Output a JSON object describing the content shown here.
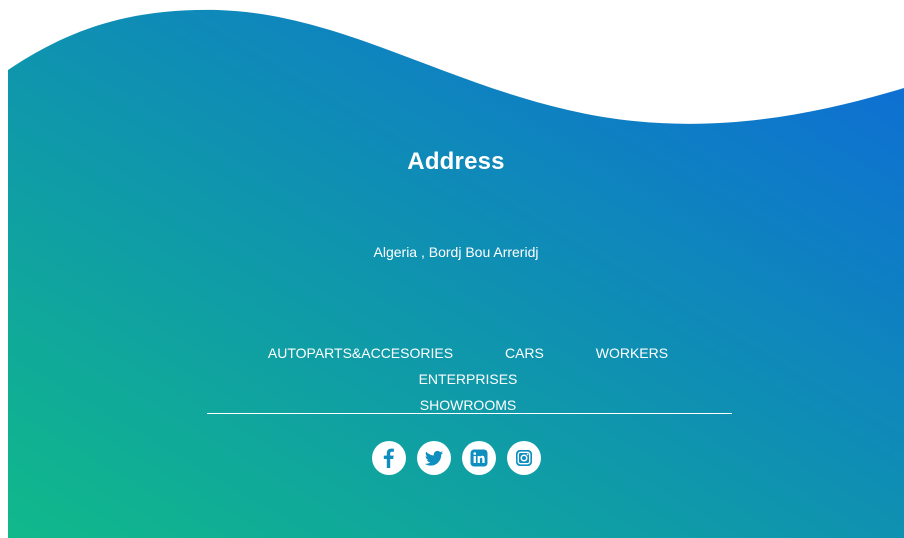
{
  "colors": {
    "gradient_start": "#10b98a",
    "gradient_end": "#0e6ad8",
    "icon_fill": "#0f8fbf",
    "text": "#ffffff"
  },
  "address": {
    "title": "Address",
    "text": "Algeria , Bordj Bou Arreridj"
  },
  "nav": {
    "items": [
      {
        "label": "AUTOPARTS&ACCESORIES"
      },
      {
        "label": "CARS"
      },
      {
        "label": "WORKERS"
      },
      {
        "label": "ENTERPRISES"
      },
      {
        "label": "SHOWROOMS"
      }
    ]
  },
  "social": [
    {
      "icon": "facebook-icon"
    },
    {
      "icon": "twitter-icon"
    },
    {
      "icon": "linkedin-icon"
    },
    {
      "icon": "instagram-icon"
    }
  ]
}
